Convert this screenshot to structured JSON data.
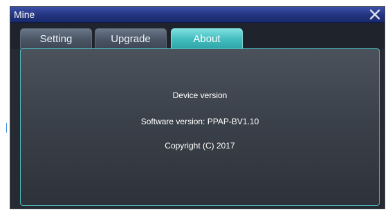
{
  "window": {
    "title": "Mine",
    "close_icon": "close-icon",
    "accent": "#44bdbf",
    "titlebar_color": "#22337e"
  },
  "tabs": [
    {
      "label": "Setting",
      "active": false
    },
    {
      "label": "Upgrade",
      "active": false
    },
    {
      "label": "About",
      "active": true
    }
  ],
  "about": {
    "device_version": "Device version",
    "software_version": "Software version: PPAP-BV1.10",
    "copyright": "Copyright (C) 2017"
  }
}
